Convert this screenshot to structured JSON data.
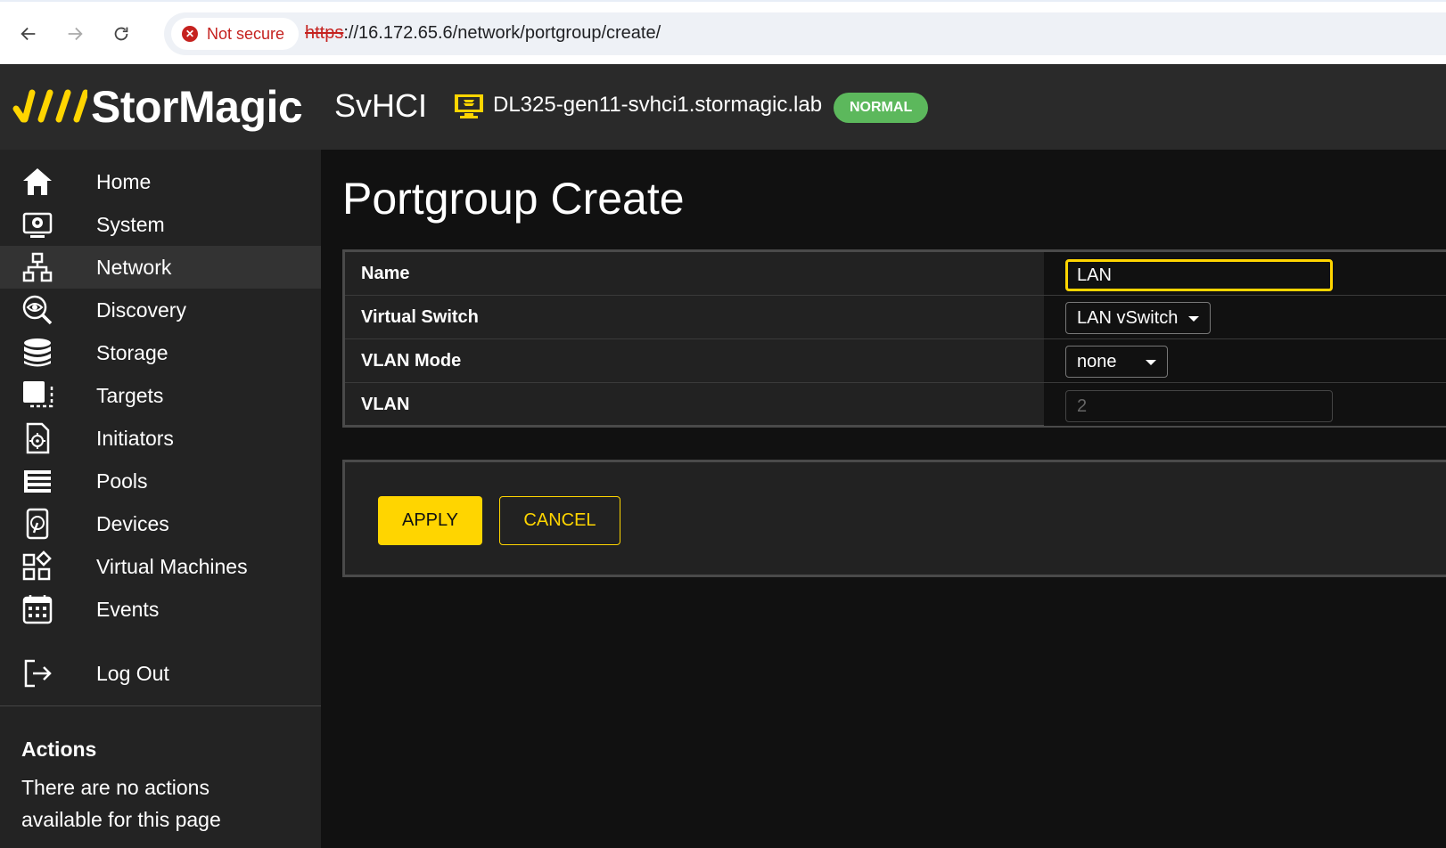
{
  "browser": {
    "security_label": "Not secure",
    "url_scheme": "https",
    "url_rest": "://16.172.65.6/network/portgroup/create/"
  },
  "header": {
    "logo_text": "StorMagic",
    "product": "SvHCI",
    "host": "DL325-gen11-svhci1.stormagic.lab",
    "status": "NORMAL",
    "brand_color": "#ffd500",
    "status_color": "#5cb85c"
  },
  "sidebar": {
    "items": [
      {
        "label": "Home",
        "icon": "home-icon"
      },
      {
        "label": "System",
        "icon": "system-icon"
      },
      {
        "label": "Network",
        "icon": "network-icon",
        "active": true
      },
      {
        "label": "Discovery",
        "icon": "discovery-icon"
      },
      {
        "label": "Storage",
        "icon": "storage-icon"
      },
      {
        "label": "Targets",
        "icon": "targets-icon"
      },
      {
        "label": "Initiators",
        "icon": "initiators-icon"
      },
      {
        "label": "Pools",
        "icon": "pools-icon"
      },
      {
        "label": "Devices",
        "icon": "devices-icon"
      },
      {
        "label": "Virtual Machines",
        "icon": "virtual-machines-icon"
      },
      {
        "label": "Events",
        "icon": "events-icon"
      }
    ],
    "logout_label": "Log Out",
    "actions_title": "Actions",
    "actions_text": "There are no actions available for this page"
  },
  "main": {
    "title": "Portgroup Create",
    "form": {
      "name_label": "Name",
      "name_value": "LAN",
      "vswitch_label": "Virtual Switch",
      "vswitch_value": "LAN vSwitch",
      "vlan_mode_label": "VLAN Mode",
      "vlan_mode_value": "none",
      "vlan_label": "VLAN",
      "vlan_value": "2"
    },
    "apply_label": "APPLY",
    "cancel_label": "CANCEL"
  }
}
